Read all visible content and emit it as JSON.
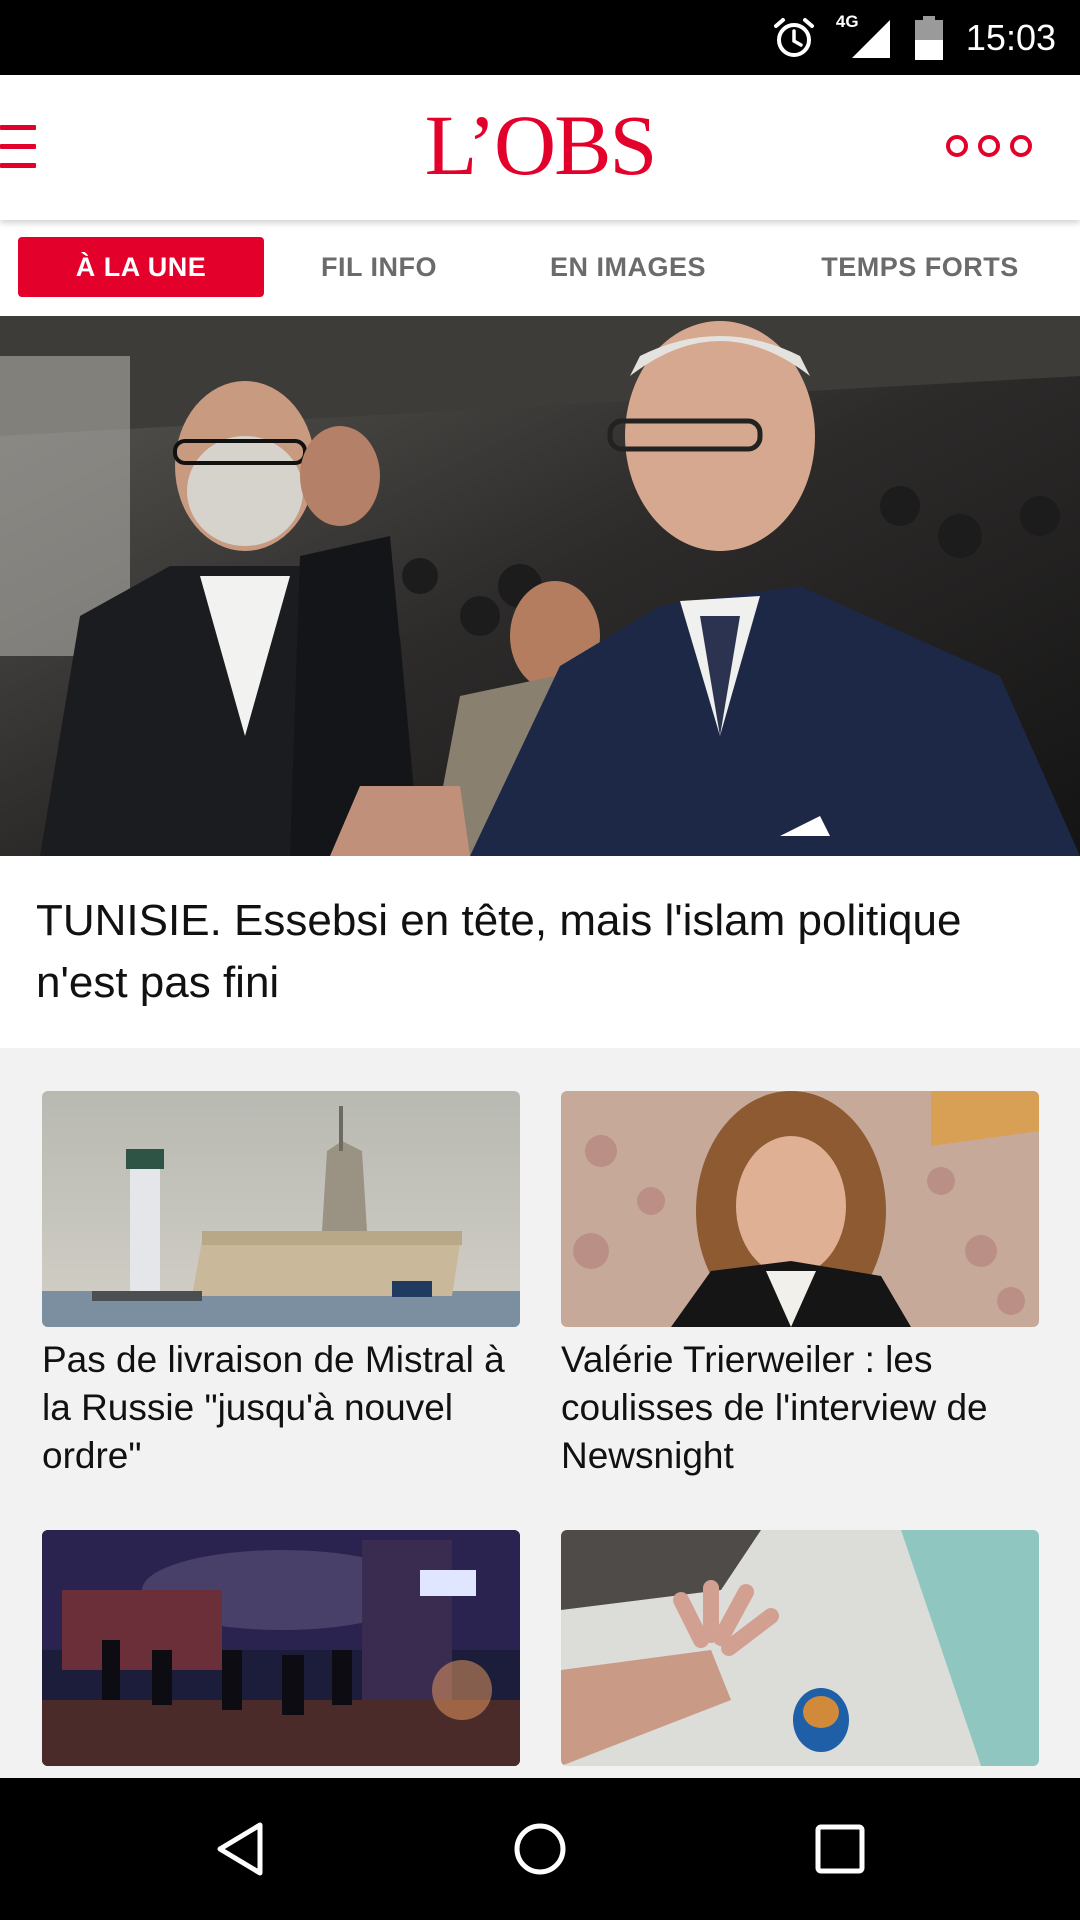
{
  "status_bar": {
    "time": "15:03",
    "network": "4G"
  },
  "app_bar": {
    "logo": "L’OBS"
  },
  "tabs": [
    {
      "label": "À LA UNE",
      "active": true
    },
    {
      "label": "FIL INFO",
      "active": false
    },
    {
      "label": "EN IMAGES",
      "active": false
    },
    {
      "label": "TEMPS FORTS",
      "active": false
    }
  ],
  "hero": {
    "title": "TUNISIE. Essebsi en tête, mais l'islam politique n'est pas fini",
    "image": "photo-two-men-shaking-hands"
  },
  "articles": [
    {
      "title": "Pas de livraison de Mistral à la Russie \"jusqu'à nouvel ordre\"",
      "image": "photo-warship-lighthouse"
    },
    {
      "title": "Valérie Trierweiler : les coulisses de l'interview de Newsnight",
      "image": "photo-woman-portrait"
    },
    {
      "title": "",
      "image": "photo-police-night-street"
    },
    {
      "title": "",
      "image": "photo-baby-hand-pacifier"
    }
  ],
  "colors": {
    "brand": "#e3002b",
    "tab_inactive": "#6b6b6b",
    "grid_bg": "#f2f2f2"
  },
  "icons": [
    "menu-icon",
    "more-icon",
    "alarm-icon",
    "signal-icon",
    "battery-icon",
    "back-icon",
    "home-icon",
    "recents-icon"
  ]
}
